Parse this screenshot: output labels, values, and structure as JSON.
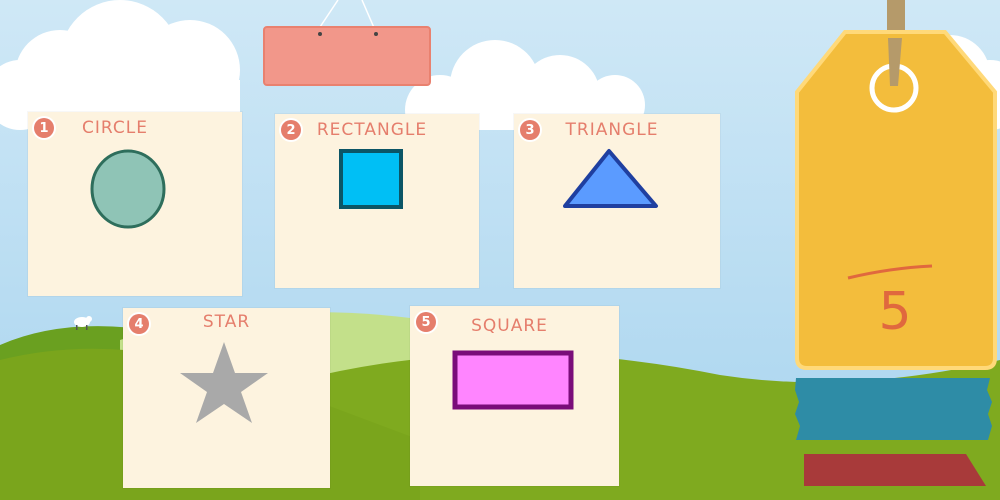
{
  "game": {
    "cards": [
      {
        "number": "1",
        "label": "CIRCLE",
        "shape": "circle",
        "fill": "#8fc4b6",
        "stroke": "#2e6e5c"
      },
      {
        "number": "2",
        "label": "RECTANGLE",
        "shape": "square",
        "fill": "#00bff5",
        "stroke": "#0b5566"
      },
      {
        "number": "3",
        "label": "TRIANGLE",
        "shape": "triangle",
        "fill": "#5b9bff",
        "stroke": "#1f3fa0"
      },
      {
        "number": "4",
        "label": "STAR",
        "shape": "star",
        "fill": "#a9a9a9",
        "stroke": "#a9a9a9"
      },
      {
        "number": "5",
        "label": "SQUARE",
        "shape": "rectangle",
        "fill": "#ff85ff",
        "stroke": "#7a0d7a"
      }
    ],
    "tag": {
      "value": "5",
      "color": "#f3bd3c"
    },
    "hanging_sign": {
      "text": "",
      "color": "#f2978a"
    },
    "buttons": {
      "blue_color": "#2e8ca6",
      "red_color": "#a83a3a"
    }
  }
}
